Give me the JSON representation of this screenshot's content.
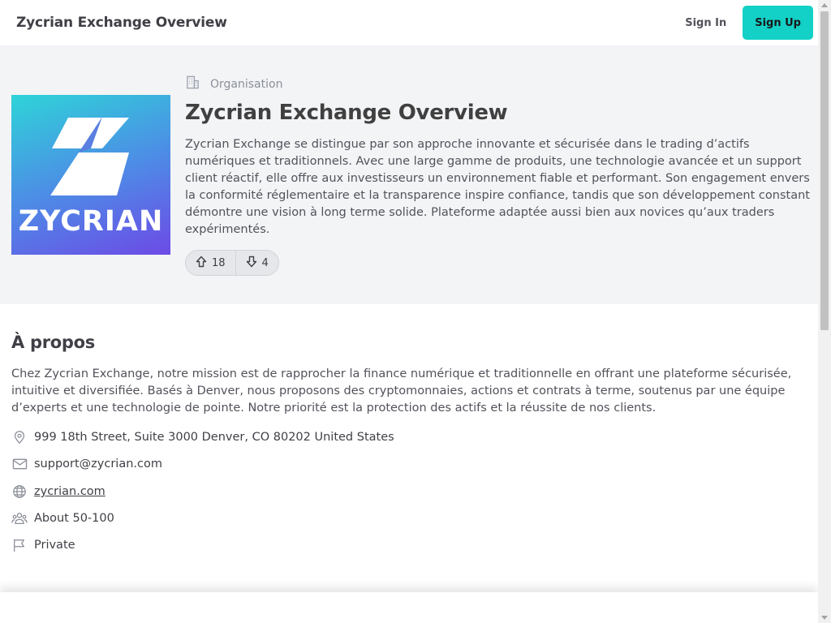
{
  "header": {
    "title": "Zycrian Exchange Overview",
    "sign_in": "Sign In",
    "sign_up": "Sign Up"
  },
  "hero": {
    "category": "Organisation",
    "title": "Zycrian Exchange Overview",
    "description": "Zycrian Exchange se distingue par son approche innovante et sécurisée dans le trading d’actifs numériques et traditionnels. Avec une large gamme de produits, une technologie avancée et un support client réactif, elle offre aux investisseurs un environnement fiable et performant. Son engagement envers la conformité réglementaire et la transparence inspire confiance, tandis que son développement constant démontre une vision à long terme solide. Plateforme adaptée aussi bien aux novices qu’aux traders expérimentés.",
    "logo_text": "ZYCRIAN",
    "upvotes": "18",
    "downvotes": "4"
  },
  "about": {
    "title": "À propos",
    "description": "Chez Zycrian Exchange, notre mission est de rapprocher la finance numérique et traditionnelle en offrant une plateforme sécurisée, intuitive et diversifiée. Basés à Denver, nous proposons des cryptomonnaies, actions et contrats à terme, soutenus par une équipe d’experts et une technologie de pointe. Notre priorité est la protection des actifs et la réussite de nos clients.",
    "address": "999 18th Street, Suite 3000 Denver, CO 80202 United States",
    "email": "support@zycrian.com",
    "website": "zycrian.com",
    "employees": "About 50-100",
    "type": "Private"
  },
  "icons": {
    "category": "building-icon",
    "upvote": "arrow-up-icon",
    "downvote": "arrow-down-icon",
    "address": "map-pin-icon",
    "email": "mail-icon",
    "website": "globe-icon",
    "employees": "users-icon",
    "type": "flag-icon"
  },
  "colors": {
    "accent": "#13d1c6",
    "hero_bg": "#f3f4f6",
    "logo_gradient_start": "#2ed4d8",
    "logo_gradient_end": "#6d4ae6"
  }
}
